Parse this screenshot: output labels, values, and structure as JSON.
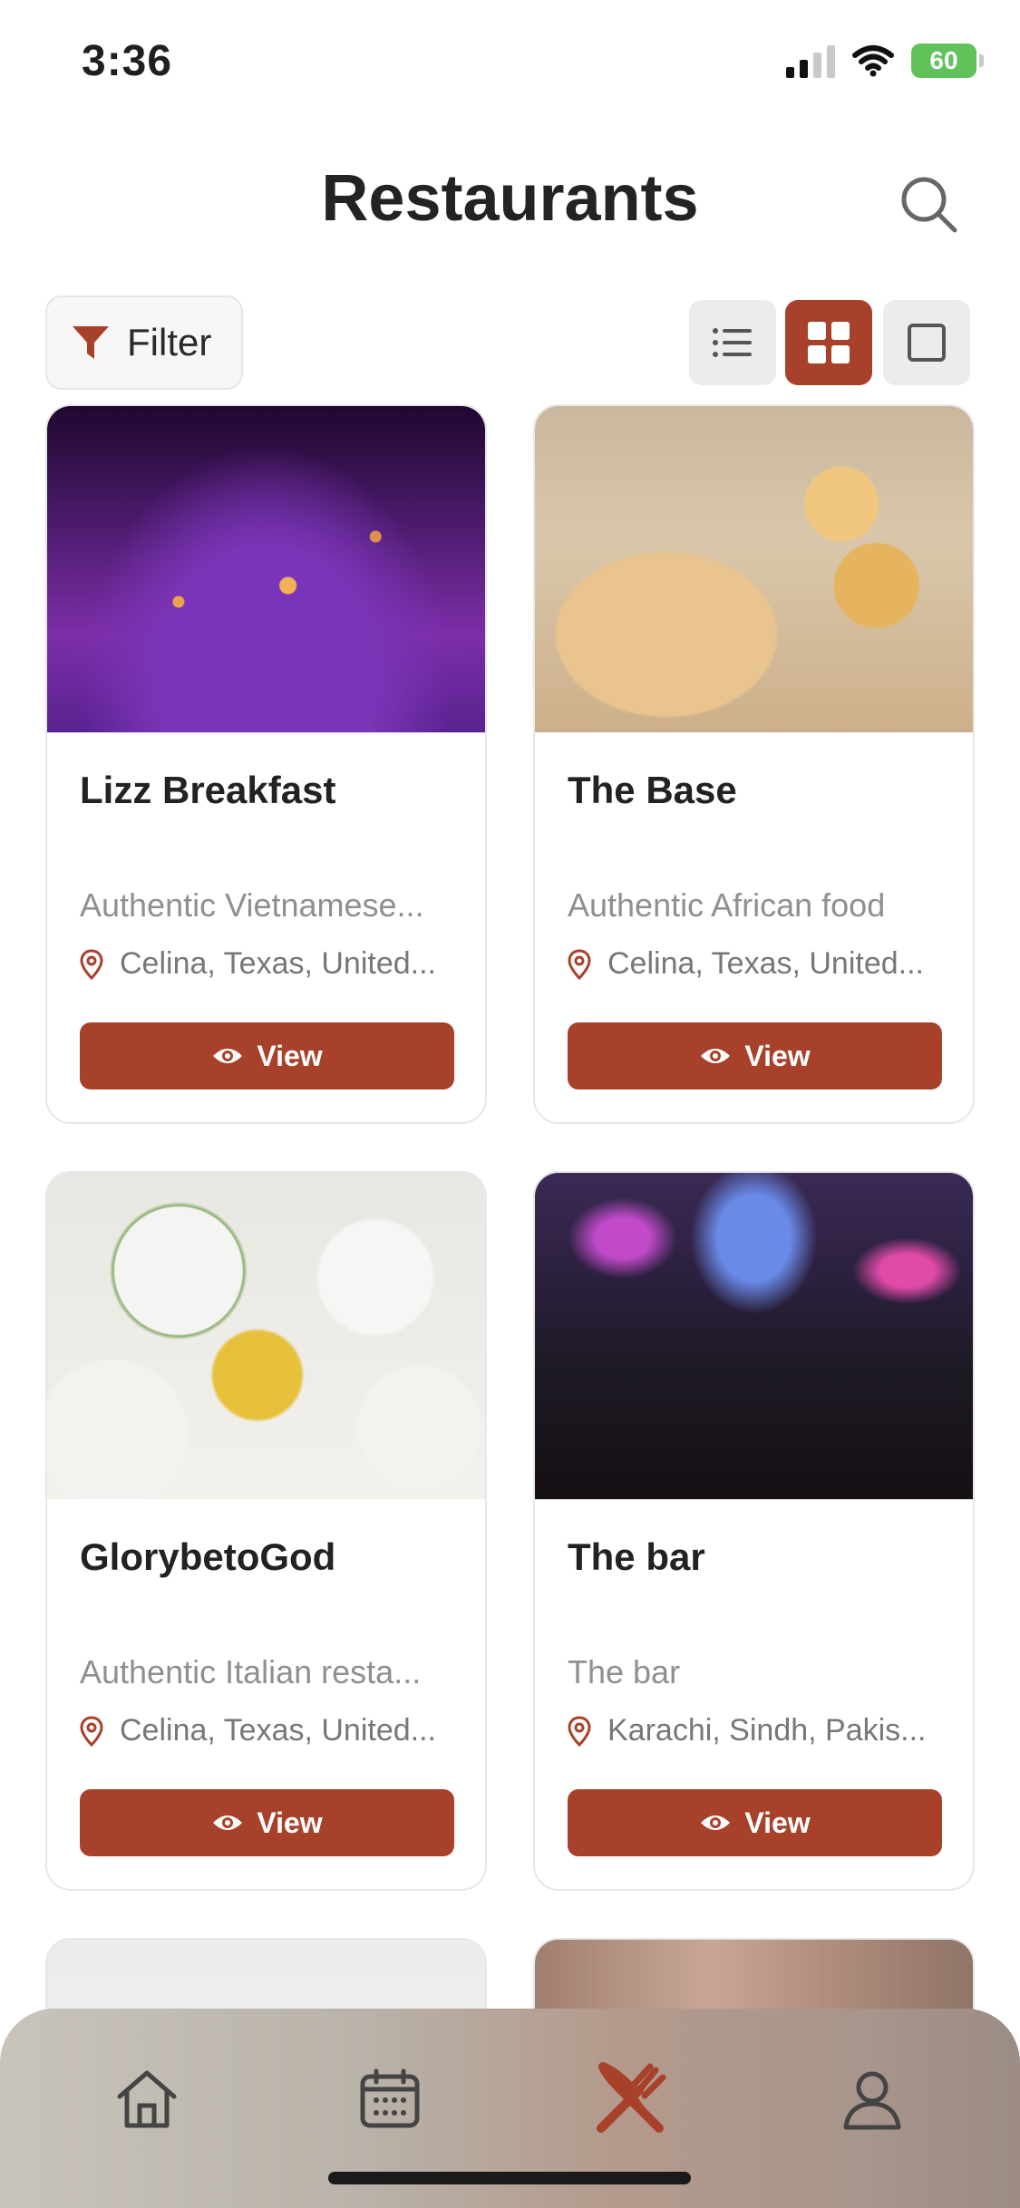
{
  "status_bar": {
    "time": "3:36",
    "battery": "60"
  },
  "header": {
    "title": "Restaurants"
  },
  "toolbar": {
    "filter_label": "Filter",
    "view_modes": [
      "list",
      "grid",
      "single"
    ],
    "active_view": "grid"
  },
  "restaurants": [
    {
      "name": "Lizz Breakfast",
      "description": "Authentic Vietnamese...",
      "location": "Celina, Texas, United...",
      "view_label": "View"
    },
    {
      "name": "The Base",
      "description": "Authentic African food",
      "location": "Celina, Texas, United...",
      "view_label": "View"
    },
    {
      "name": "GlorybetoGod",
      "description": "Authentic Italian resta...",
      "location": "Celina, Texas, United...",
      "view_label": "View"
    },
    {
      "name": "The bar",
      "description": "The bar",
      "location": "Karachi, Sindh, Pakis...",
      "view_label": "View"
    }
  ],
  "tab_bar": {
    "tabs": [
      "home",
      "calendar",
      "restaurants",
      "profile"
    ],
    "active": "restaurants"
  },
  "colors": {
    "accent": "#a8412a",
    "battery": "#5fc25b"
  }
}
